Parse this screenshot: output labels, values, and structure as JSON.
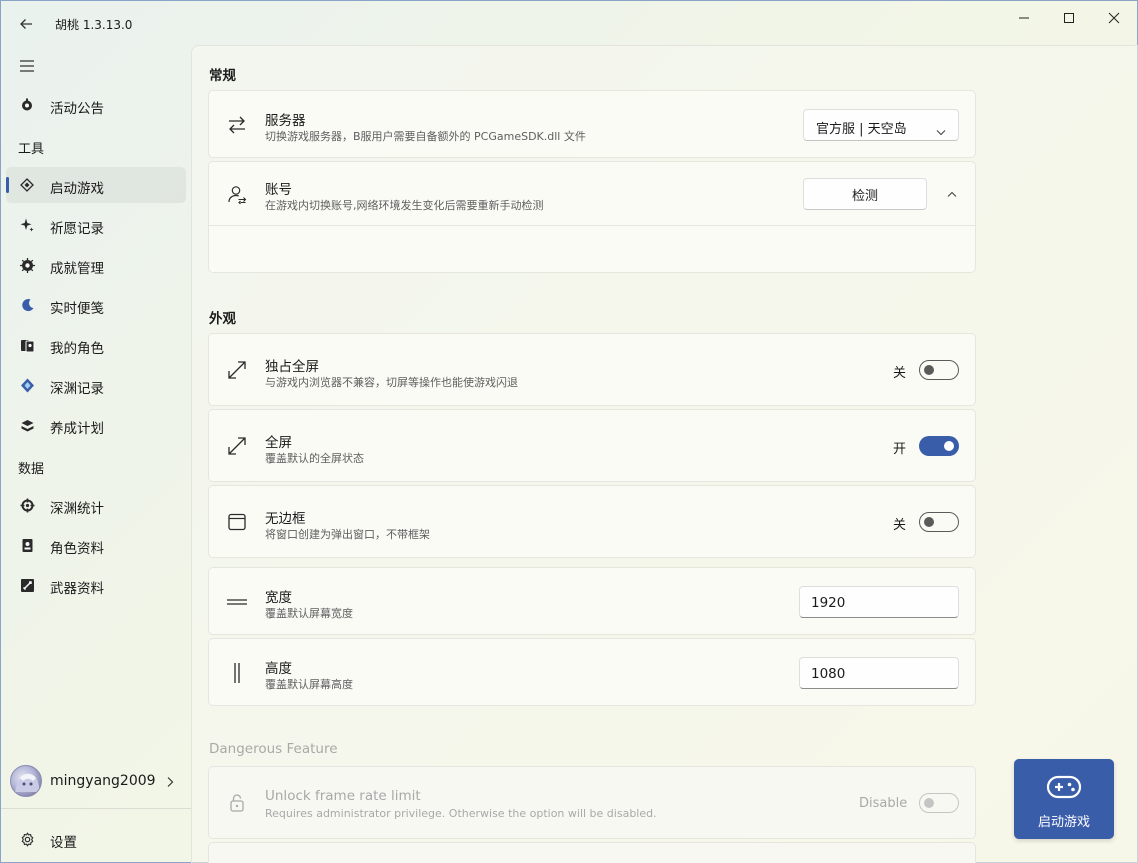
{
  "window": {
    "title": "胡桃 1.3.13.0"
  },
  "sidebar": {
    "items": [
      {
        "label": "活动公告",
        "icon": "announcement-icon"
      },
      {
        "label": "启动游戏",
        "icon": "game-launcher-icon",
        "active": true
      },
      {
        "label": "祈愿记录",
        "icon": "wish-sparkle-icon"
      },
      {
        "label": "成就管理",
        "icon": "achievement-icon"
      },
      {
        "label": "实时便笺",
        "icon": "realtime-note-icon"
      },
      {
        "label": "我的角色",
        "icon": "my-characters-icon"
      },
      {
        "label": "深渊记录",
        "icon": "abyss-record-icon"
      },
      {
        "label": "养成计划",
        "icon": "cultivation-icon"
      },
      {
        "label": "深渊统计",
        "icon": "abyss-statistics-icon"
      },
      {
        "label": "角色资料",
        "icon": "character-wiki-icon"
      },
      {
        "label": "武器资料",
        "icon": "weapon-wiki-icon"
      }
    ],
    "headers": {
      "tools": "工具",
      "data": "数据"
    },
    "user": {
      "name": "mingyang2009"
    },
    "settings_label": "设置"
  },
  "main": {
    "sections": {
      "general": "常规",
      "appearance": "外观",
      "dangerous": "Dangerous Feature"
    },
    "server": {
      "title": "服务器",
      "desc": "切换游戏服务器，B服用户需要自备额外的 PCGameSDK.dll 文件",
      "value": "官方服 | 天空岛"
    },
    "account": {
      "title": "账号",
      "desc": "在游戏内切换账号,网络环境发生变化后需要重新手动检测",
      "button": "检测"
    },
    "exclusive_fullscreen": {
      "title": "独占全屏",
      "desc": "与游戏内浏览器不兼容，切屏等操作也能使游戏闪退",
      "state": "关",
      "on": false
    },
    "fullscreen": {
      "title": "全屏",
      "desc": "覆盖默认的全屏状态",
      "state": "开",
      "on": true
    },
    "borderless": {
      "title": "无边框",
      "desc": "将窗口创建为弹出窗口，不带框架",
      "state": "关",
      "on": false
    },
    "width": {
      "title": "宽度",
      "desc": "覆盖默认屏幕宽度",
      "value": "1920"
    },
    "height": {
      "title": "高度",
      "desc": "覆盖默认屏幕高度",
      "value": "1080"
    },
    "unlock_fps": {
      "title": "Unlock frame rate limit",
      "desc": "Requires administrator privilege. Otherwise the option will be disabled.",
      "state": "Disable",
      "on": false
    }
  },
  "launch": {
    "label": "启动游戏"
  },
  "colors": {
    "accent": "#3a5daa"
  }
}
